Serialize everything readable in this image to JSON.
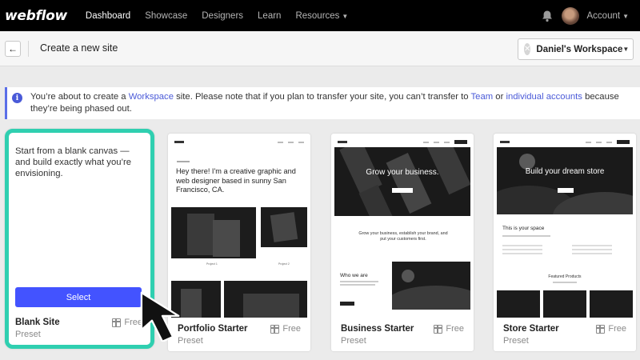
{
  "nav": {
    "logo": "webflow",
    "links": [
      {
        "label": "Dashboard",
        "active": true
      },
      {
        "label": "Showcase",
        "active": false
      },
      {
        "label": "Designers",
        "active": false
      },
      {
        "label": "Learn",
        "active": false
      },
      {
        "label": "Resources",
        "active": false
      }
    ],
    "account_label": "Account",
    "icons": [
      "bell-icon",
      "avatar"
    ]
  },
  "header": {
    "back_icon": "arrow-left-icon",
    "title": "Create a new site",
    "workspace_label": "Daniel's Workspace"
  },
  "banner": {
    "text_1": "You’re about to create a ",
    "link_1": "Workspace",
    "text_2": " site. Please note that if you plan to transfer your site, you can’t transfer to ",
    "link_2": "Team",
    "text_3": " or ",
    "link_3": "individual accounts",
    "text_4": " because they’re being phased out."
  },
  "cards": [
    {
      "name": "Blank Site",
      "preset": "Preset",
      "price": "Free",
      "description": "Start from a blank canvas — and build exactly what you’re envisioning.",
      "select_label": "Select"
    },
    {
      "name": "Portfolio Starter",
      "preset": "Preset",
      "price": "Free",
      "preview": {
        "heading_small": "Hey there! I'm a creative graphic and web designer based in sunny San Francisco, CA.",
        "project_1": "Project 1",
        "project_2": "Project 2"
      }
    },
    {
      "name": "Business Starter",
      "preset": "Preset",
      "price": "Free",
      "preview": {
        "hero": "Grow your business.",
        "tagline": "Grow your business, establish your brand, and put your customers first.",
        "who": "Who we are"
      }
    },
    {
      "name": "Store Starter",
      "preset": "Preset",
      "price": "Free",
      "preview": {
        "hero": "Build your dream store",
        "space": "This is your space",
        "featured": "Featured Products"
      }
    }
  ],
  "colors": {
    "accent": "#4353ff",
    "selection": "#2fcfb0",
    "link": "#4a5ad8",
    "nav_bg": "#000000"
  }
}
